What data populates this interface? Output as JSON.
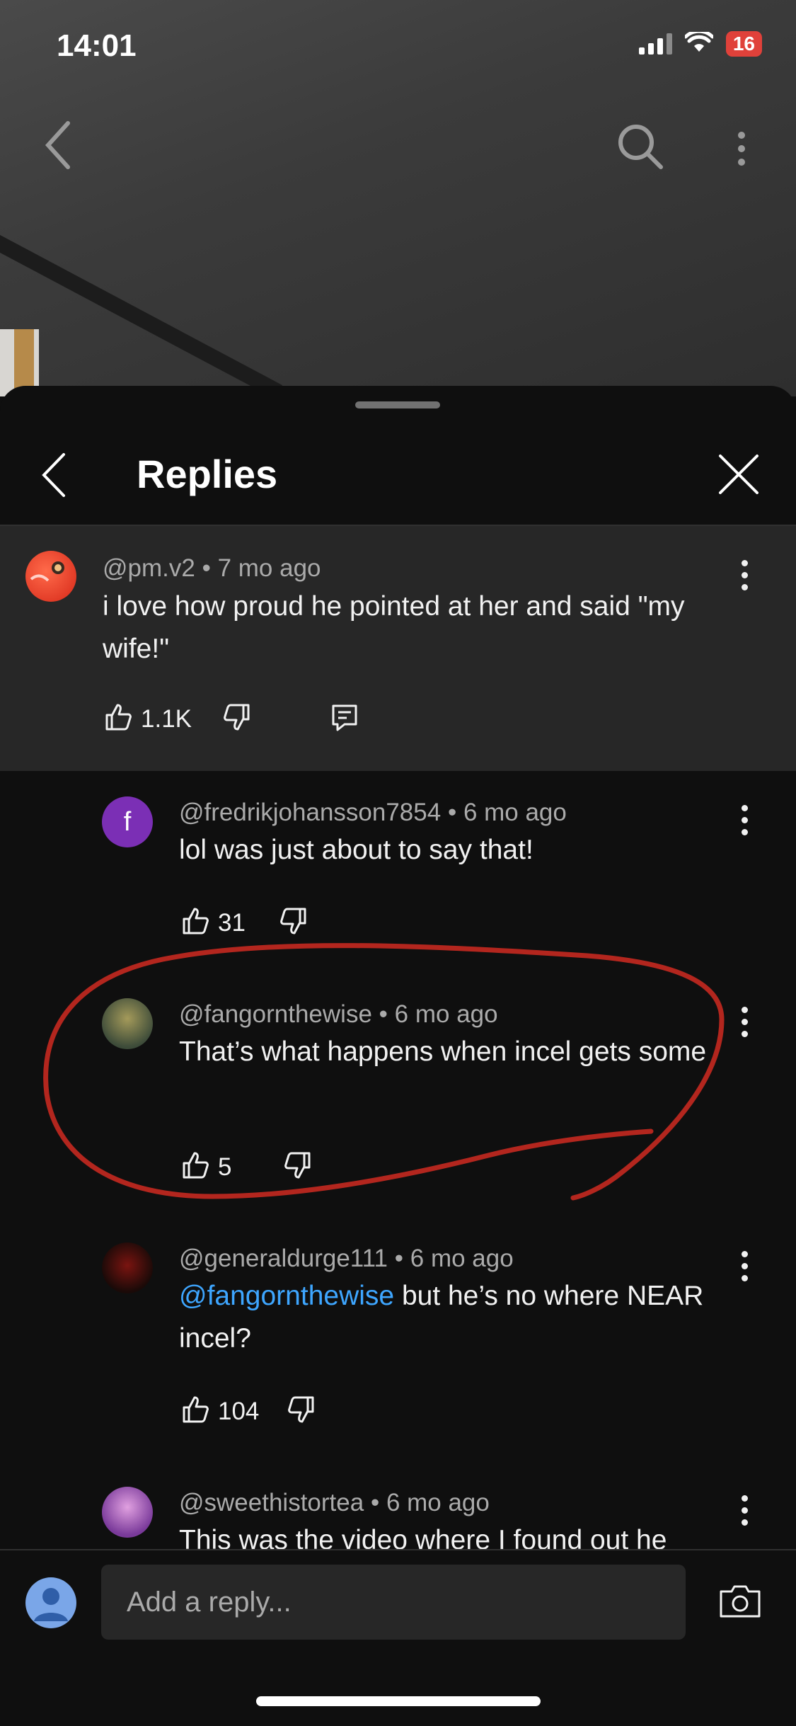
{
  "status_bar": {
    "time": "14:01",
    "battery": "16"
  },
  "header": {
    "title": "Replies"
  },
  "parent_comment": {
    "author": "@pm.v2",
    "age": "7 mo ago",
    "text": "i love how proud he pointed at her and said \"my wife!\"",
    "likes": "1.1K"
  },
  "replies": [
    {
      "author": "@fredrikjohansson7854",
      "age": "6 mo ago",
      "avatar_letter": "f",
      "mention": "",
      "text": "lol was just about to say that!",
      "likes": "31"
    },
    {
      "author": "@fangornthewise",
      "age": "6 mo ago",
      "mention": "",
      "text": "That’s what happens when incel gets some",
      "likes": "5"
    },
    {
      "author": "@generaldurge111",
      "age": "6 mo ago",
      "mention": "@fangornthewise",
      "text": " but he’s no where NEAR incel?",
      "likes": "104"
    },
    {
      "author": "@sweethistortea",
      "age": "6 mo ago",
      "mention": "",
      "text": "This was the video where I found out he"
    }
  ],
  "separator": "•",
  "footer": {
    "reply_placeholder": "Add a reply..."
  },
  "colors": {
    "annotation_red": "#b3261e",
    "mention_blue": "#3ea6ff"
  }
}
